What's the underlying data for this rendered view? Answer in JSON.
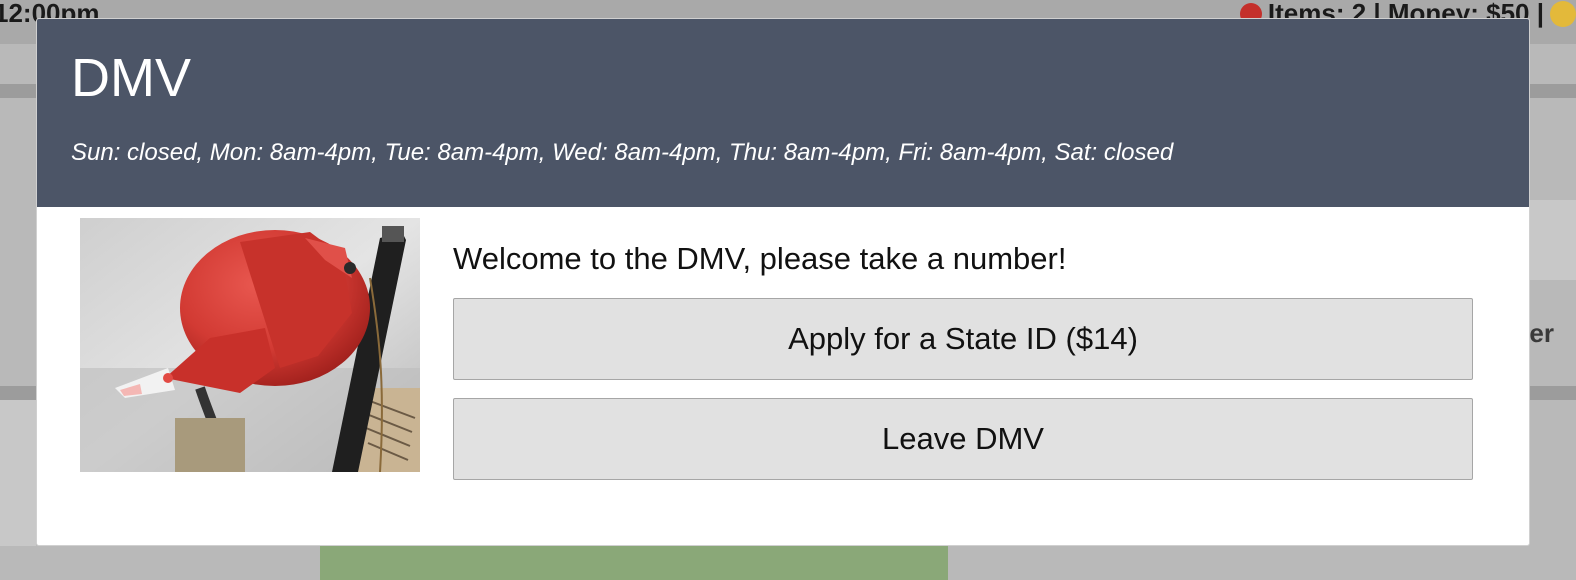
{
  "background": {
    "time": "12:00pm",
    "status": "Items: 2 | Money: $50 |",
    "side_text": "er"
  },
  "modal": {
    "title": "DMV",
    "hours": "Sun: closed, Mon: 8am-4pm, Tue: 8am-4pm, Wed: 8am-4pm, Thu: 8am-4pm, Fri: 8am-4pm, Sat: closed",
    "welcome": "Welcome to the DMV, please take a number!",
    "buttons": {
      "apply_label": "Apply for a State ID ($14)",
      "leave_label": "Leave DMV"
    }
  },
  "colors": {
    "header_bg": "#4c5567",
    "button_bg": "#e1e1e1",
    "dispenser_red": "#d23a33"
  }
}
